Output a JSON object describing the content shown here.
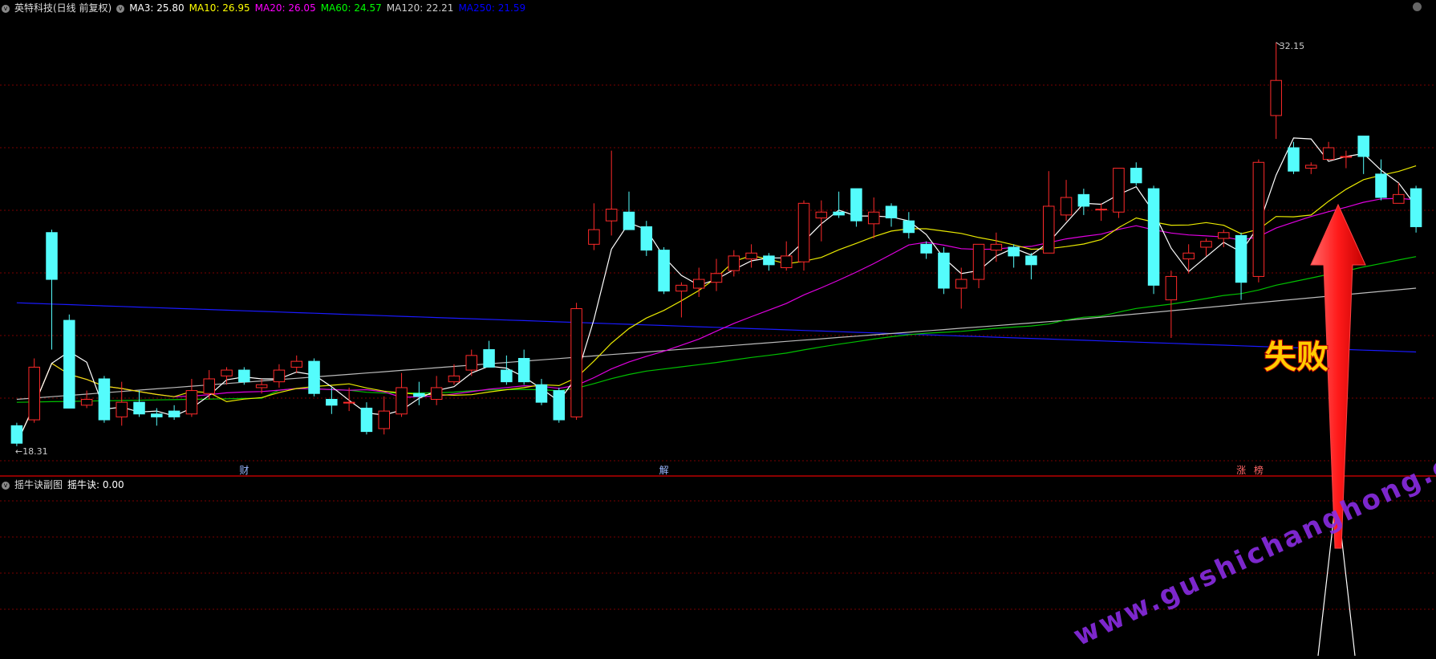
{
  "header": {
    "title": "英特科技(日线 前复权)",
    "ma": [
      {
        "label": "MA3: 25.80",
        "color": "#ffffff"
      },
      {
        "label": "MA10: 26.95",
        "color": "#ffff00"
      },
      {
        "label": "MA20: 26.05",
        "color": "#ff00ff"
      },
      {
        "label": "MA60: 24.57",
        "color": "#00ff00"
      },
      {
        "label": "MA120: 22.21",
        "color": "#cccccc"
      },
      {
        "label": "MA250: 21.59",
        "color": "#0000ff"
      }
    ]
  },
  "subpanel": {
    "title": "摇牛诀副图",
    "indicator": "摇牛诀: 0.00"
  },
  "annotation": {
    "text": "失败",
    "color_text": "#ffcc00",
    "color_arrow": "#ff1a1a"
  },
  "watermark": "www.gushichanghong.com",
  "markers": [
    {
      "text": "财",
      "color": "#9ab8ff",
      "index": 13
    },
    {
      "text": "解",
      "color": "#9ab8ff",
      "index": 37
    },
    {
      "text": "涨",
      "color": "#ff6666",
      "index": 70
    },
    {
      "text": "榜",
      "color": "#ff6666",
      "index": 71
    }
  ],
  "colors": {
    "up": "#ff2a2a",
    "down": "#54fcfc",
    "grid": "#7a0000",
    "ma3": "#ffffff",
    "ma10": "#e8e800",
    "ma20": "#e000e0",
    "ma60": "#00c000",
    "ma120": "#bbbbbb",
    "ma250": "#1a1aff"
  },
  "chart_data": {
    "type": "candlestick",
    "ylim": [
      17.5,
      33.0
    ],
    "price_labels": {
      "high": "32.15",
      "low": "18.31"
    },
    "candles": [
      [
        19.0,
        18.4,
        19.1,
        18.3
      ],
      [
        19.2,
        21.0,
        21.3,
        19.1
      ],
      [
        25.6,
        24.0,
        25.7,
        21.6
      ],
      [
        22.6,
        19.6,
        22.8,
        19.6
      ],
      [
        19.7,
        19.9,
        20.2,
        19.6
      ],
      [
        20.6,
        19.2,
        20.7,
        19.1
      ],
      [
        19.3,
        19.8,
        20.5,
        19.0
      ],
      [
        19.8,
        19.4,
        20.2,
        19.3
      ],
      [
        19.4,
        19.3,
        19.6,
        19.0
      ],
      [
        19.5,
        19.3,
        19.7,
        19.2
      ],
      [
        19.4,
        20.2,
        20.6,
        19.3
      ],
      [
        20.1,
        20.6,
        20.9,
        19.9
      ],
      [
        20.7,
        20.9,
        21.0,
        20.4
      ],
      [
        20.9,
        20.5,
        21.0,
        20.4
      ],
      [
        20.3,
        20.4,
        20.6,
        20.1
      ],
      [
        20.5,
        20.9,
        21.1,
        20.3
      ],
      [
        21.0,
        21.2,
        21.4,
        20.8
      ],
      [
        21.2,
        20.1,
        21.3,
        20.0
      ],
      [
        19.9,
        19.7,
        20.3,
        19.4
      ],
      [
        19.8,
        19.8,
        20.3,
        19.5
      ],
      [
        19.6,
        18.8,
        19.8,
        18.7
      ],
      [
        18.9,
        19.5,
        20.0,
        18.7
      ],
      [
        19.4,
        20.3,
        20.8,
        19.3
      ],
      [
        20.1,
        20.0,
        20.5,
        19.7
      ],
      [
        19.9,
        20.3,
        20.7,
        19.7
      ],
      [
        20.5,
        20.7,
        21.1,
        20.4
      ],
      [
        20.9,
        21.4,
        21.6,
        20.7
      ],
      [
        21.6,
        21.0,
        21.9,
        21.0
      ],
      [
        20.9,
        20.5,
        21.4,
        20.4
      ],
      [
        21.3,
        20.5,
        21.6,
        20.4
      ],
      [
        20.4,
        19.8,
        20.6,
        19.7
      ],
      [
        20.2,
        19.2,
        20.3,
        19.1
      ],
      [
        19.3,
        23.0,
        23.2,
        19.2
      ],
      [
        25.2,
        25.7,
        26.6,
        25.0
      ],
      [
        26.0,
        26.4,
        28.4,
        25.5
      ],
      [
        26.3,
        25.7,
        27.0,
        25.7
      ],
      [
        25.8,
        25.0,
        26.0,
        24.8
      ],
      [
        25.0,
        23.6,
        25.1,
        23.5
      ],
      [
        23.6,
        23.8,
        23.9,
        22.7
      ],
      [
        23.7,
        24.0,
        24.4,
        23.4
      ],
      [
        23.9,
        24.2,
        24.7,
        23.6
      ],
      [
        24.3,
        24.8,
        25.0,
        24.1
      ],
      [
        24.7,
        24.9,
        25.2,
        24.4
      ],
      [
        24.8,
        24.5,
        24.9,
        24.3
      ],
      [
        24.4,
        24.8,
        25.3,
        24.3
      ],
      [
        24.6,
        26.6,
        26.7,
        24.3
      ],
      [
        26.1,
        26.3,
        26.7,
        25.3
      ],
      [
        26.3,
        26.2,
        27.0,
        26.1
      ],
      [
        27.1,
        26.0,
        27.1,
        25.8
      ],
      [
        25.9,
        26.3,
        26.8,
        25.4
      ],
      [
        26.5,
        26.1,
        26.6,
        25.8
      ],
      [
        26.0,
        25.6,
        26.3,
        25.4
      ],
      [
        25.2,
        24.9,
        25.3,
        24.7
      ],
      [
        24.9,
        23.7,
        25.1,
        23.5
      ],
      [
        23.7,
        24.0,
        24.4,
        23.0
      ],
      [
        24.0,
        25.2,
        25.2,
        23.7
      ],
      [
        25.0,
        25.2,
        25.6,
        24.6
      ],
      [
        25.1,
        24.8,
        25.2,
        24.4
      ],
      [
        24.8,
        24.5,
        24.9,
        24.0
      ],
      [
        24.9,
        26.5,
        27.7,
        24.9
      ],
      [
        26.2,
        26.8,
        27.4,
        26.0
      ],
      [
        26.9,
        26.5,
        27.1,
        26.2
      ],
      [
        26.4,
        26.4,
        26.6,
        26.0
      ],
      [
        26.3,
        27.8,
        27.8,
        26.1
      ],
      [
        27.8,
        27.3,
        28.0,
        27.2
      ],
      [
        27.1,
        23.8,
        27.2,
        23.5
      ],
      [
        23.3,
        24.1,
        24.3,
        22.0
      ],
      [
        24.7,
        24.9,
        25.2,
        24.2
      ],
      [
        25.1,
        25.3,
        25.4,
        24.8
      ],
      [
        25.4,
        25.6,
        25.7,
        25.1
      ],
      [
        25.5,
        23.9,
        25.6,
        23.3
      ],
      [
        24.1,
        28.0,
        28.1,
        23.9
      ],
      [
        29.6,
        30.8,
        32.1,
        28.8
      ],
      [
        28.5,
        27.7,
        28.7,
        27.6
      ],
      [
        27.8,
        27.9,
        28.0,
        27.6
      ],
      [
        28.1,
        28.5,
        28.7,
        28.1
      ],
      [
        28.2,
        28.2,
        28.4,
        27.8
      ],
      [
        28.9,
        28.2,
        28.9,
        27.6
      ],
      [
        27.6,
        26.8,
        28.1,
        26.7
      ],
      [
        26.6,
        26.9,
        27.3,
        26.6
      ],
      [
        27.1,
        25.8,
        27.2,
        25.6
      ]
    ]
  }
}
